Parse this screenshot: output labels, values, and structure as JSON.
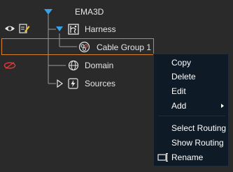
{
  "tree": {
    "root": {
      "label": "EMA3D",
      "icon": "triangle-down-icon"
    },
    "harness": {
      "label": "Harness",
      "icon": "harness-icon",
      "expander": "triangle-down-icon"
    },
    "cable_group": {
      "label": "Cable Group 1",
      "icon": "cable-group-icon",
      "selected": true
    },
    "domain": {
      "label": "Domain",
      "icon": "globe-icon"
    },
    "sources": {
      "label": "Sources",
      "icon": "lightning-icon",
      "expander": "triangle-right-icon"
    },
    "row_icons": {
      "harness_visibility": "eye-icon",
      "harness_edit": "edit-icon",
      "domain_visibility": "eye-hidden-icon"
    }
  },
  "context_menu": {
    "items": [
      {
        "label": "Copy"
      },
      {
        "label": "Delete"
      },
      {
        "label": "Edit"
      },
      {
        "label": "Add",
        "has_submenu": true
      },
      {
        "label": "Select Routing"
      },
      {
        "label": "Show Routing"
      },
      {
        "label": "Rename",
        "icon": "rename-icon"
      }
    ]
  },
  "colors": {
    "background": "#2a2a2a",
    "menu_background": "#0e1b26",
    "selection_border": "#d9822b",
    "expander_blue": "#3aa0e8",
    "hidden_red": "#e03a3a"
  }
}
